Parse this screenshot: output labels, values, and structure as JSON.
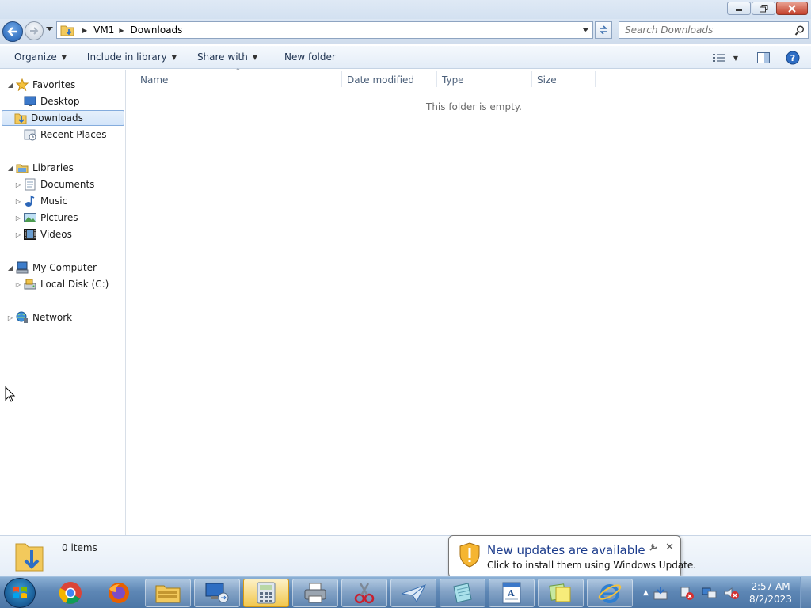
{
  "window": {
    "controls": [
      "minimize-icon",
      "restore-icon",
      "close-icon"
    ]
  },
  "address": {
    "crumbs": [
      "VM1",
      "Downloads"
    ],
    "search_placeholder": "Search Downloads"
  },
  "toolbar": {
    "organize": "Organize",
    "include_in_library": "Include in library",
    "share_with": "Share with",
    "new_folder": "New folder"
  },
  "nav": {
    "favorites": "Favorites",
    "desktop": "Desktop",
    "downloads": "Downloads",
    "recent_places": "Recent Places",
    "libraries": "Libraries",
    "documents": "Documents",
    "music": "Music",
    "pictures": "Pictures",
    "videos": "Videos",
    "my_computer": "My Computer",
    "local_disk": "Local Disk (C:)",
    "network": "Network"
  },
  "content": {
    "columns": [
      "Name",
      "Date modified",
      "Type",
      "Size"
    ],
    "empty_message": "This folder is empty."
  },
  "details": {
    "item_count": "0 items"
  },
  "notification": {
    "title": "New updates are available",
    "message": "Click to install them using Windows Update."
  },
  "clock": {
    "time": "2:57 AM",
    "date": "8/2/2023"
  },
  "taskbar": {
    "apps": [
      "chrome-icon",
      "firefox-icon",
      "file-explorer-icon",
      "remote-desktop-icon",
      "calculator-icon",
      "printer-icon",
      "snipping-tool-icon",
      "paper-plane-icon",
      "notepad-icon",
      "wordpad-icon",
      "sticky-notes-icon",
      "internet-explorer-icon"
    ]
  },
  "colors": {
    "taskbar": "#5e87b5",
    "selection_border": "#84acdd",
    "title_link": "#1c3c8c"
  }
}
